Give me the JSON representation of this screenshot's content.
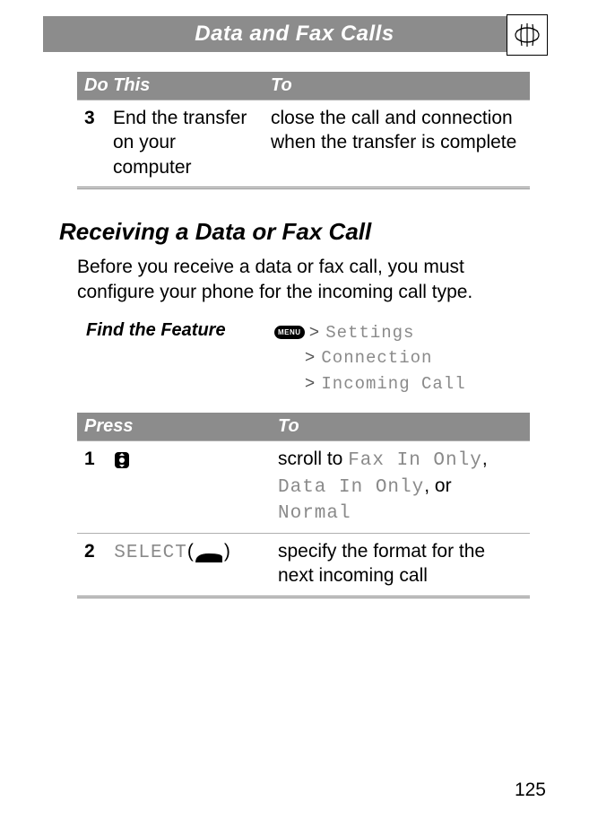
{
  "header": {
    "title": "Data and Fax Calls",
    "icon_name": "data-fax-icon"
  },
  "table1": {
    "head_do": "Do This",
    "head_to": "To",
    "rows": [
      {
        "num": "3",
        "do": "End the transfer on your computer",
        "to": "close the call and connection when the transfer is complete"
      }
    ]
  },
  "section": {
    "title": "Receiving a Data or Fax Call",
    "intro": "Before you receive a data or fax call, you must configure your phone for the incoming call type."
  },
  "find_feature": {
    "label": "Find the Feature",
    "menu_btn": "MENU",
    "path1": "Settings",
    "path2": "Connection",
    "path3": "Incoming Call",
    "gt": ">"
  },
  "table2": {
    "head_press": "Press",
    "head_to": "To",
    "rows": [
      {
        "num": "1",
        "press_icon": "nav-key-icon",
        "to_pre": "scroll to ",
        "to_code1": "Fax In Only",
        "to_mid1": ", ",
        "to_code2": "Data In Only",
        "to_mid2": ", or ",
        "to_code3": "Normal"
      },
      {
        "num": "2",
        "press_code": "SELECT",
        "press_paren_open": "(",
        "press_paren_close": ")",
        "press_softkey": "left-softkey-icon",
        "to": "specify the format for the next incoming call"
      }
    ]
  },
  "page_number": "125"
}
